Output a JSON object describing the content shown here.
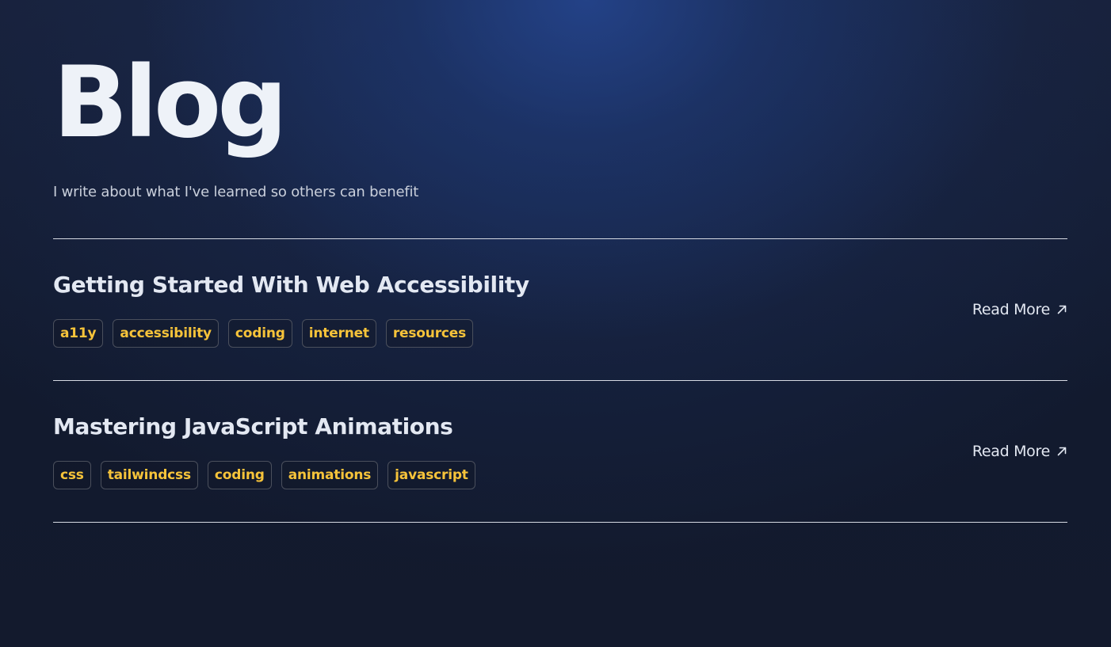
{
  "header": {
    "title": "Blog",
    "subtitle": "I write about what I've learned so others can benefit"
  },
  "posts": [
    {
      "title": "Getting Started With Web Accessibility",
      "tags": [
        "a11y",
        "accessibility",
        "coding",
        "internet",
        "resources"
      ],
      "read_more_label": "Read More",
      "read_more_icon": "arrow-up-right-icon"
    },
    {
      "title": "Mastering JavaScript Animations",
      "tags": [
        "css",
        "tailwindcss",
        "coding",
        "animations",
        "javascript"
      ],
      "read_more_label": "Read More",
      "read_more_icon": "arrow-up-right-icon"
    }
  ],
  "colors": {
    "background": "#111827",
    "accent_glow": "#254691",
    "tag_text": "#f6c33a",
    "text": "#e3e8f2"
  }
}
